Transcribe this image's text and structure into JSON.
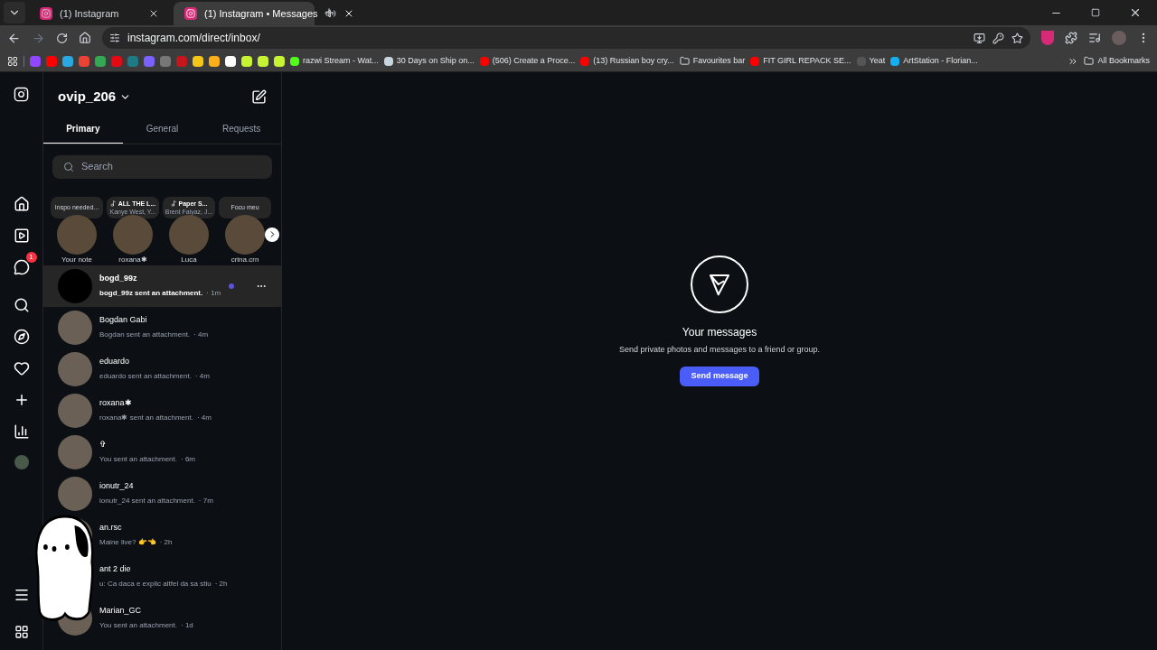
{
  "browser": {
    "tabs": [
      {
        "title": "(1) Instagram",
        "selected": false,
        "audio": false
      },
      {
        "title": "(1) Instagram • Messages",
        "selected": true,
        "audio": true
      }
    ],
    "url": "instagram.com/direct/inbox/",
    "bookmarks": [
      {
        "kind": "icon",
        "color": "#9146ff"
      },
      {
        "kind": "icon",
        "color": "#ff0000"
      },
      {
        "kind": "icon",
        "color": "#2aa9e0"
      },
      {
        "kind": "icon",
        "color": "#ea4335"
      },
      {
        "kind": "icon",
        "color": "#34a853"
      },
      {
        "kind": "icon",
        "color": "#e50914"
      },
      {
        "kind": "icon",
        "color": "#1e7b85"
      },
      {
        "kind": "icon",
        "color": "#7b61ff"
      },
      {
        "kind": "icon",
        "color": "#777777"
      },
      {
        "kind": "icon",
        "color": "#c4161c"
      },
      {
        "kind": "icon",
        "color": "#f5c518"
      },
      {
        "kind": "icon",
        "color": "#fcaf17"
      },
      {
        "kind": "icon",
        "color": "#ffffff"
      },
      {
        "kind": "icon",
        "color": "#c6f432"
      },
      {
        "kind": "icon",
        "color": "#c6f432"
      },
      {
        "kind": "icon",
        "color": "#c6f432"
      },
      {
        "kind": "link",
        "label": "razwi Stream - Wat...",
        "color": "#53fc18"
      },
      {
        "kind": "link",
        "label": "30 Days on Ship on...",
        "color": "#c7d5e0"
      },
      {
        "kind": "link",
        "label": "(506) Create a Proce...",
        "color": "#ff0000"
      },
      {
        "kind": "link",
        "label": "(13) Russian boy cry...",
        "color": "#ff0000"
      },
      {
        "kind": "folder",
        "label": "Favourites bar"
      },
      {
        "kind": "link",
        "label": "FIT GIRL REPACK SE...",
        "color": "#ff0000"
      },
      {
        "kind": "link",
        "label": "Yeat",
        "color": "#555555"
      },
      {
        "kind": "link",
        "label": "ArtStation - Florian...",
        "color": "#13aff0"
      }
    ],
    "all_bookmarks": "All Bookmarks"
  },
  "nav": {
    "notification_count": "1"
  },
  "inbox": {
    "username": "ovip_206",
    "tabs": [
      {
        "label": "Primary",
        "selected": true
      },
      {
        "label": "General",
        "selected": false
      },
      {
        "label": "Requests",
        "selected": false
      }
    ],
    "search": {
      "placeholder": "Search"
    },
    "notes": [
      {
        "note": "Inspo needed...",
        "name": "Your note",
        "kind": "text"
      },
      {
        "note": "ALL THE L...",
        "sub": "Kanye West, Y...",
        "name": "roxana✱",
        "kind": "music"
      },
      {
        "note": "Paper S...",
        "sub": "Brent Faiyaz, J...",
        "name": "Luca",
        "kind": "music"
      },
      {
        "note": "Focu meu",
        "name": "crina.crn",
        "kind": "text"
      }
    ],
    "threads": [
      {
        "name": "bogd_99z",
        "preview": "bogd_99z sent an attachment.",
        "time": "· 1m",
        "unread": true,
        "selected": true
      },
      {
        "name": "Bogdan Gabi",
        "preview": "Bogdan sent an attachment.",
        "time": "· 4m",
        "unread": false,
        "selected": false
      },
      {
        "name": "eduardo",
        "preview": "eduardo sent an attachment.",
        "time": "· 4m",
        "unread": false,
        "selected": false
      },
      {
        "name": "roxana✱",
        "preview": "roxana✱ sent an attachment.",
        "time": "· 4m",
        "unread": false,
        "selected": false
      },
      {
        "name": "✞",
        "preview": "You sent an attachment.",
        "time": "· 6m",
        "unread": false,
        "selected": false
      },
      {
        "name": "ionutr_24",
        "preview": "ionutr_24 sent an attachment.",
        "time": "· 7m",
        "unread": false,
        "selected": false
      },
      {
        "name": "an.rsc",
        "preview": "Maine live? 👉👈",
        "time": "· 2h",
        "unread": false,
        "selected": false
      },
      {
        "name": "ant 2 die",
        "preview": "u: Ca daca e explic altfel da sa stiu",
        "time": "· 2h",
        "unread": false,
        "selected": false
      },
      {
        "name": "Marian_GC",
        "preview": "You sent an attachment.",
        "time": "· 1d",
        "unread": false,
        "selected": false
      }
    ]
  },
  "empty_state": {
    "title": "Your messages",
    "text": "Send private photos and messages to a friend or group.",
    "button": "Send message"
  }
}
